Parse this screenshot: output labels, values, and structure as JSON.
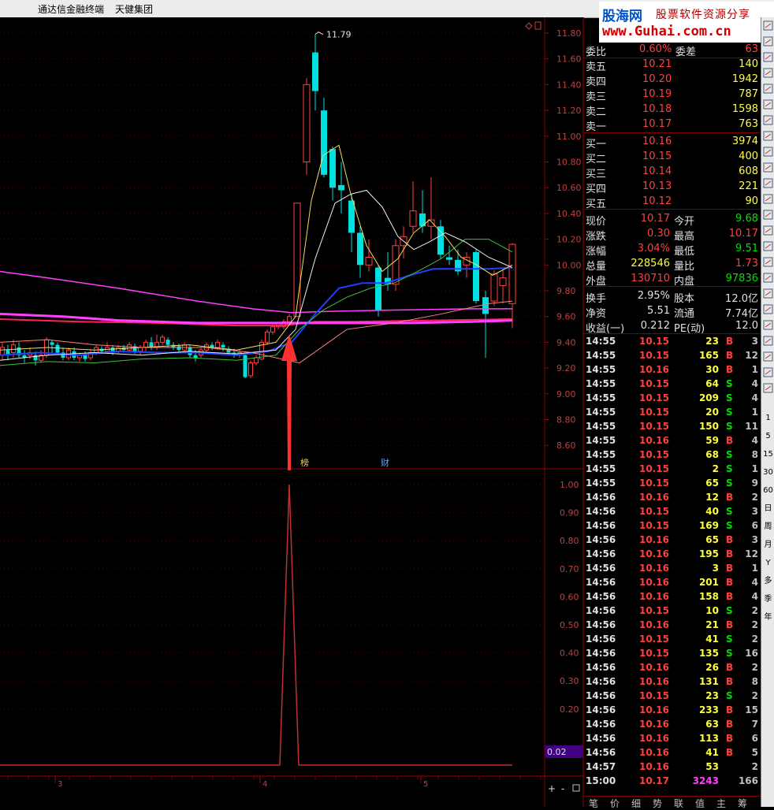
{
  "titlebar": {
    "app": "通达信金融终端",
    "stock": "天健集团"
  },
  "watermark": {
    "brand": "股海网",
    "slogan": "股票软件资源分享",
    "url": "www.Guhai.com.cn"
  },
  "price_axis": [
    "11.80",
    "11.60",
    "11.40",
    "11.20",
    "11.00",
    "10.80",
    "10.60",
    "10.40",
    "10.20",
    "10.00",
    "9.80",
    "9.60",
    "9.40",
    "9.20",
    "9.00",
    "8.80",
    "8.60"
  ],
  "ind_axis": [
    "1.00",
    "0.90",
    "0.80",
    "0.70",
    "0.60",
    "0.50",
    "0.40",
    "0.30",
    "0.20"
  ],
  "ind_current": "0.02",
  "peak_label": "11.79",
  "markers": {
    "bang": "榜",
    "cai": "财"
  },
  "date_labels": [
    "3",
    "4",
    "5"
  ],
  "zoom": {
    "plus": "+",
    "minus": "-"
  },
  "quote": {
    "weibi_label": "委比",
    "weibi": "0.60%",
    "weicha_label": "委差",
    "weicha": "63",
    "asks": [
      {
        "label": "卖五",
        "price": "10.21",
        "vol": "140"
      },
      {
        "label": "卖四",
        "price": "10.20",
        "vol": "1942"
      },
      {
        "label": "卖三",
        "price": "10.19",
        "vol": "787"
      },
      {
        "label": "卖二",
        "price": "10.18",
        "vol": "1598"
      },
      {
        "label": "卖一",
        "price": "10.17",
        "vol": "763"
      }
    ],
    "bids": [
      {
        "label": "买一",
        "price": "10.16",
        "vol": "3974"
      },
      {
        "label": "买二",
        "price": "10.15",
        "vol": "400"
      },
      {
        "label": "买三",
        "price": "10.14",
        "vol": "608"
      },
      {
        "label": "买四",
        "price": "10.13",
        "vol": "221"
      },
      {
        "label": "买五",
        "price": "10.12",
        "vol": "90"
      }
    ],
    "stats": [
      {
        "l1": "现价",
        "v1": "10.17",
        "c1": "red",
        "l2": "今开",
        "v2": "9.68",
        "c2": "green"
      },
      {
        "l1": "涨跌",
        "v1": "0.30",
        "c1": "red",
        "l2": "最高",
        "v2": "10.17",
        "c2": "red"
      },
      {
        "l1": "涨幅",
        "v1": "3.04%",
        "c1": "red",
        "l2": "最低",
        "v2": "9.51",
        "c2": "green"
      },
      {
        "l1": "总量",
        "v1": "228546",
        "c1": "yellow",
        "l2": "量比",
        "v2": "1.73",
        "c2": "red"
      },
      {
        "l1": "外盘",
        "v1": "130710",
        "c1": "red",
        "l2": "内盘",
        "v2": "97836",
        "c2": "green"
      }
    ],
    "fin": [
      {
        "l1": "换手",
        "v1": "2.95%",
        "l2": "股本",
        "v2": "12.0亿"
      },
      {
        "l1": "净资",
        "v1": "5.51",
        "l2": "流通",
        "v2": "7.74亿"
      },
      {
        "l1": "收益(一)",
        "v1": "0.212",
        "l2": "PE(动)",
        "v2": "12.0"
      }
    ]
  },
  "ticks": [
    {
      "t": "14:55",
      "p": "10.15",
      "v": "23",
      "bs": "B",
      "n": "3"
    },
    {
      "t": "14:55",
      "p": "10.15",
      "v": "165",
      "bs": "B",
      "n": "12"
    },
    {
      "t": "14:55",
      "p": "10.16",
      "v": "30",
      "bs": "B",
      "n": "1"
    },
    {
      "t": "14:55",
      "p": "10.15",
      "v": "64",
      "bs": "S",
      "n": "4"
    },
    {
      "t": "14:55",
      "p": "10.15",
      "v": "209",
      "bs": "S",
      "n": "4"
    },
    {
      "t": "14:55",
      "p": "10.15",
      "v": "20",
      "bs": "S",
      "n": "1"
    },
    {
      "t": "14:55",
      "p": "10.15",
      "v": "150",
      "bs": "S",
      "n": "11"
    },
    {
      "t": "14:55",
      "p": "10.16",
      "v": "59",
      "bs": "B",
      "n": "4"
    },
    {
      "t": "14:55",
      "p": "10.15",
      "v": "68",
      "bs": "S",
      "n": "8"
    },
    {
      "t": "14:55",
      "p": "10.15",
      "v": "2",
      "bs": "S",
      "n": "1"
    },
    {
      "t": "14:55",
      "p": "10.15",
      "v": "65",
      "bs": "S",
      "n": "9"
    },
    {
      "t": "14:56",
      "p": "10.16",
      "v": "12",
      "bs": "B",
      "n": "2"
    },
    {
      "t": "14:56",
      "p": "10.15",
      "v": "40",
      "bs": "S",
      "n": "3"
    },
    {
      "t": "14:56",
      "p": "10.15",
      "v": "169",
      "bs": "S",
      "n": "6"
    },
    {
      "t": "14:56",
      "p": "10.16",
      "v": "65",
      "bs": "B",
      "n": "3"
    },
    {
      "t": "14:56",
      "p": "10.16",
      "v": "195",
      "bs": "B",
      "n": "12"
    },
    {
      "t": "14:56",
      "p": "10.16",
      "v": "3",
      "bs": "B",
      "n": "1"
    },
    {
      "t": "14:56",
      "p": "10.16",
      "v": "201",
      "bs": "B",
      "n": "4"
    },
    {
      "t": "14:56",
      "p": "10.16",
      "v": "158",
      "bs": "B",
      "n": "4"
    },
    {
      "t": "14:56",
      "p": "10.15",
      "v": "10",
      "bs": "S",
      "n": "2"
    },
    {
      "t": "14:56",
      "p": "10.16",
      "v": "21",
      "bs": "B",
      "n": "2"
    },
    {
      "t": "14:56",
      "p": "10.15",
      "v": "41",
      "bs": "S",
      "n": "2"
    },
    {
      "t": "14:56",
      "p": "10.15",
      "v": "135",
      "bs": "S",
      "n": "16"
    },
    {
      "t": "14:56",
      "p": "10.16",
      "v": "26",
      "bs": "B",
      "n": "2"
    },
    {
      "t": "14:56",
      "p": "10.16",
      "v": "131",
      "bs": "B",
      "n": "8"
    },
    {
      "t": "14:56",
      "p": "10.15",
      "v": "23",
      "bs": "S",
      "n": "2"
    },
    {
      "t": "14:56",
      "p": "10.16",
      "v": "233",
      "bs": "B",
      "n": "15"
    },
    {
      "t": "14:56",
      "p": "10.16",
      "v": "63",
      "bs": "B",
      "n": "7"
    },
    {
      "t": "14:56",
      "p": "10.16",
      "v": "113",
      "bs": "B",
      "n": "6"
    },
    {
      "t": "14:56",
      "p": "10.16",
      "v": "41",
      "bs": "B",
      "n": "5"
    },
    {
      "t": "14:57",
      "p": "10.16",
      "v": "53",
      "bs": "",
      "n": "2"
    },
    {
      "t": "15:00",
      "p": "10.17",
      "v": "3243",
      "bs": "",
      "n": "166"
    }
  ],
  "bottom_tabs": [
    "笔",
    "价",
    "细",
    "势",
    "联",
    "值",
    "主",
    "筹"
  ],
  "sidebar_labels": [
    "1",
    "5",
    "15",
    "30",
    "60",
    "日",
    "周",
    "月",
    "Y",
    "多",
    "季",
    "年"
  ],
  "colors": {
    "up": "#ff4040",
    "down": "#00e0e0",
    "bg": "#000000",
    "border": "#800000"
  }
}
